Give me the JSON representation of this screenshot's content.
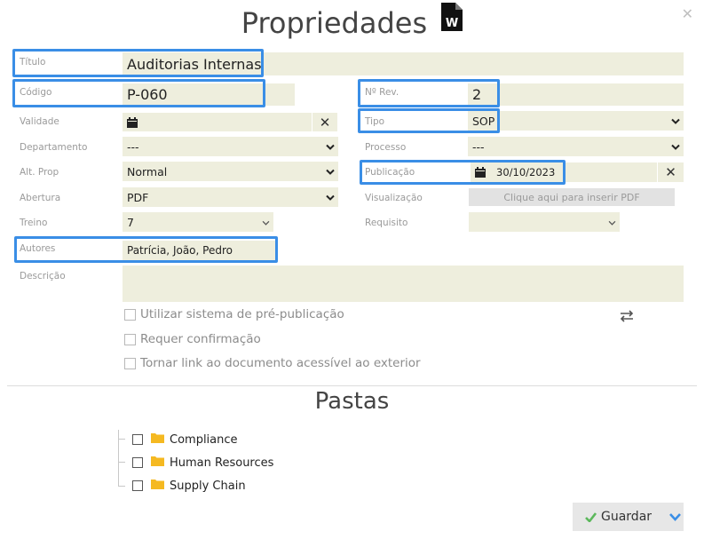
{
  "dialog": {
    "title": "Propriedades",
    "doc_icon_letter": "W"
  },
  "form": {
    "titulo": {
      "label": "Título",
      "value": "Auditorias Internas"
    },
    "codigo": {
      "label": "Código",
      "value": "P-060"
    },
    "rev": {
      "label": "Nº Rev.",
      "value": "2"
    },
    "validade": {
      "label": "Validade",
      "value": ""
    },
    "tipo": {
      "label": "Tipo",
      "value": "SOP"
    },
    "departamento": {
      "label": "Departamento",
      "value": "---"
    },
    "processo": {
      "label": "Processo",
      "value": "---"
    },
    "alt_prop": {
      "label": "Alt. Prop",
      "value": "Normal"
    },
    "publicacao": {
      "label": "Publicação",
      "value": "30/10/2023"
    },
    "abertura": {
      "label": "Abertura",
      "value": "PDF"
    },
    "visualizacao": {
      "label": "Visualização",
      "button": "Clique aqui para inserir PDF"
    },
    "treino": {
      "label": "Treino",
      "value": "7"
    },
    "requisito": {
      "label": "Requisito",
      "value": ""
    },
    "autores": {
      "label": "Autores",
      "value": "Patrícia, João, Pedro"
    },
    "descricao": {
      "label": "Descrição",
      "value": ""
    }
  },
  "options": [
    {
      "label": "Utilizar sistema de pré-publicação",
      "checked": false
    },
    {
      "label": "Requer confirmação",
      "checked": false
    },
    {
      "label": "Tornar link ao documento acessível ao exterior",
      "checked": false
    }
  ],
  "pastas": {
    "title": "Pastas",
    "folders": [
      "Compliance",
      "Human Resources",
      "Supply Chain"
    ]
  },
  "actions": {
    "save_label": "Guardar"
  },
  "colors": {
    "accent": "#3a8ee6",
    "field_bg": "#eeeedd",
    "folder": "#f5b921",
    "check_green": "#5cb85c"
  }
}
